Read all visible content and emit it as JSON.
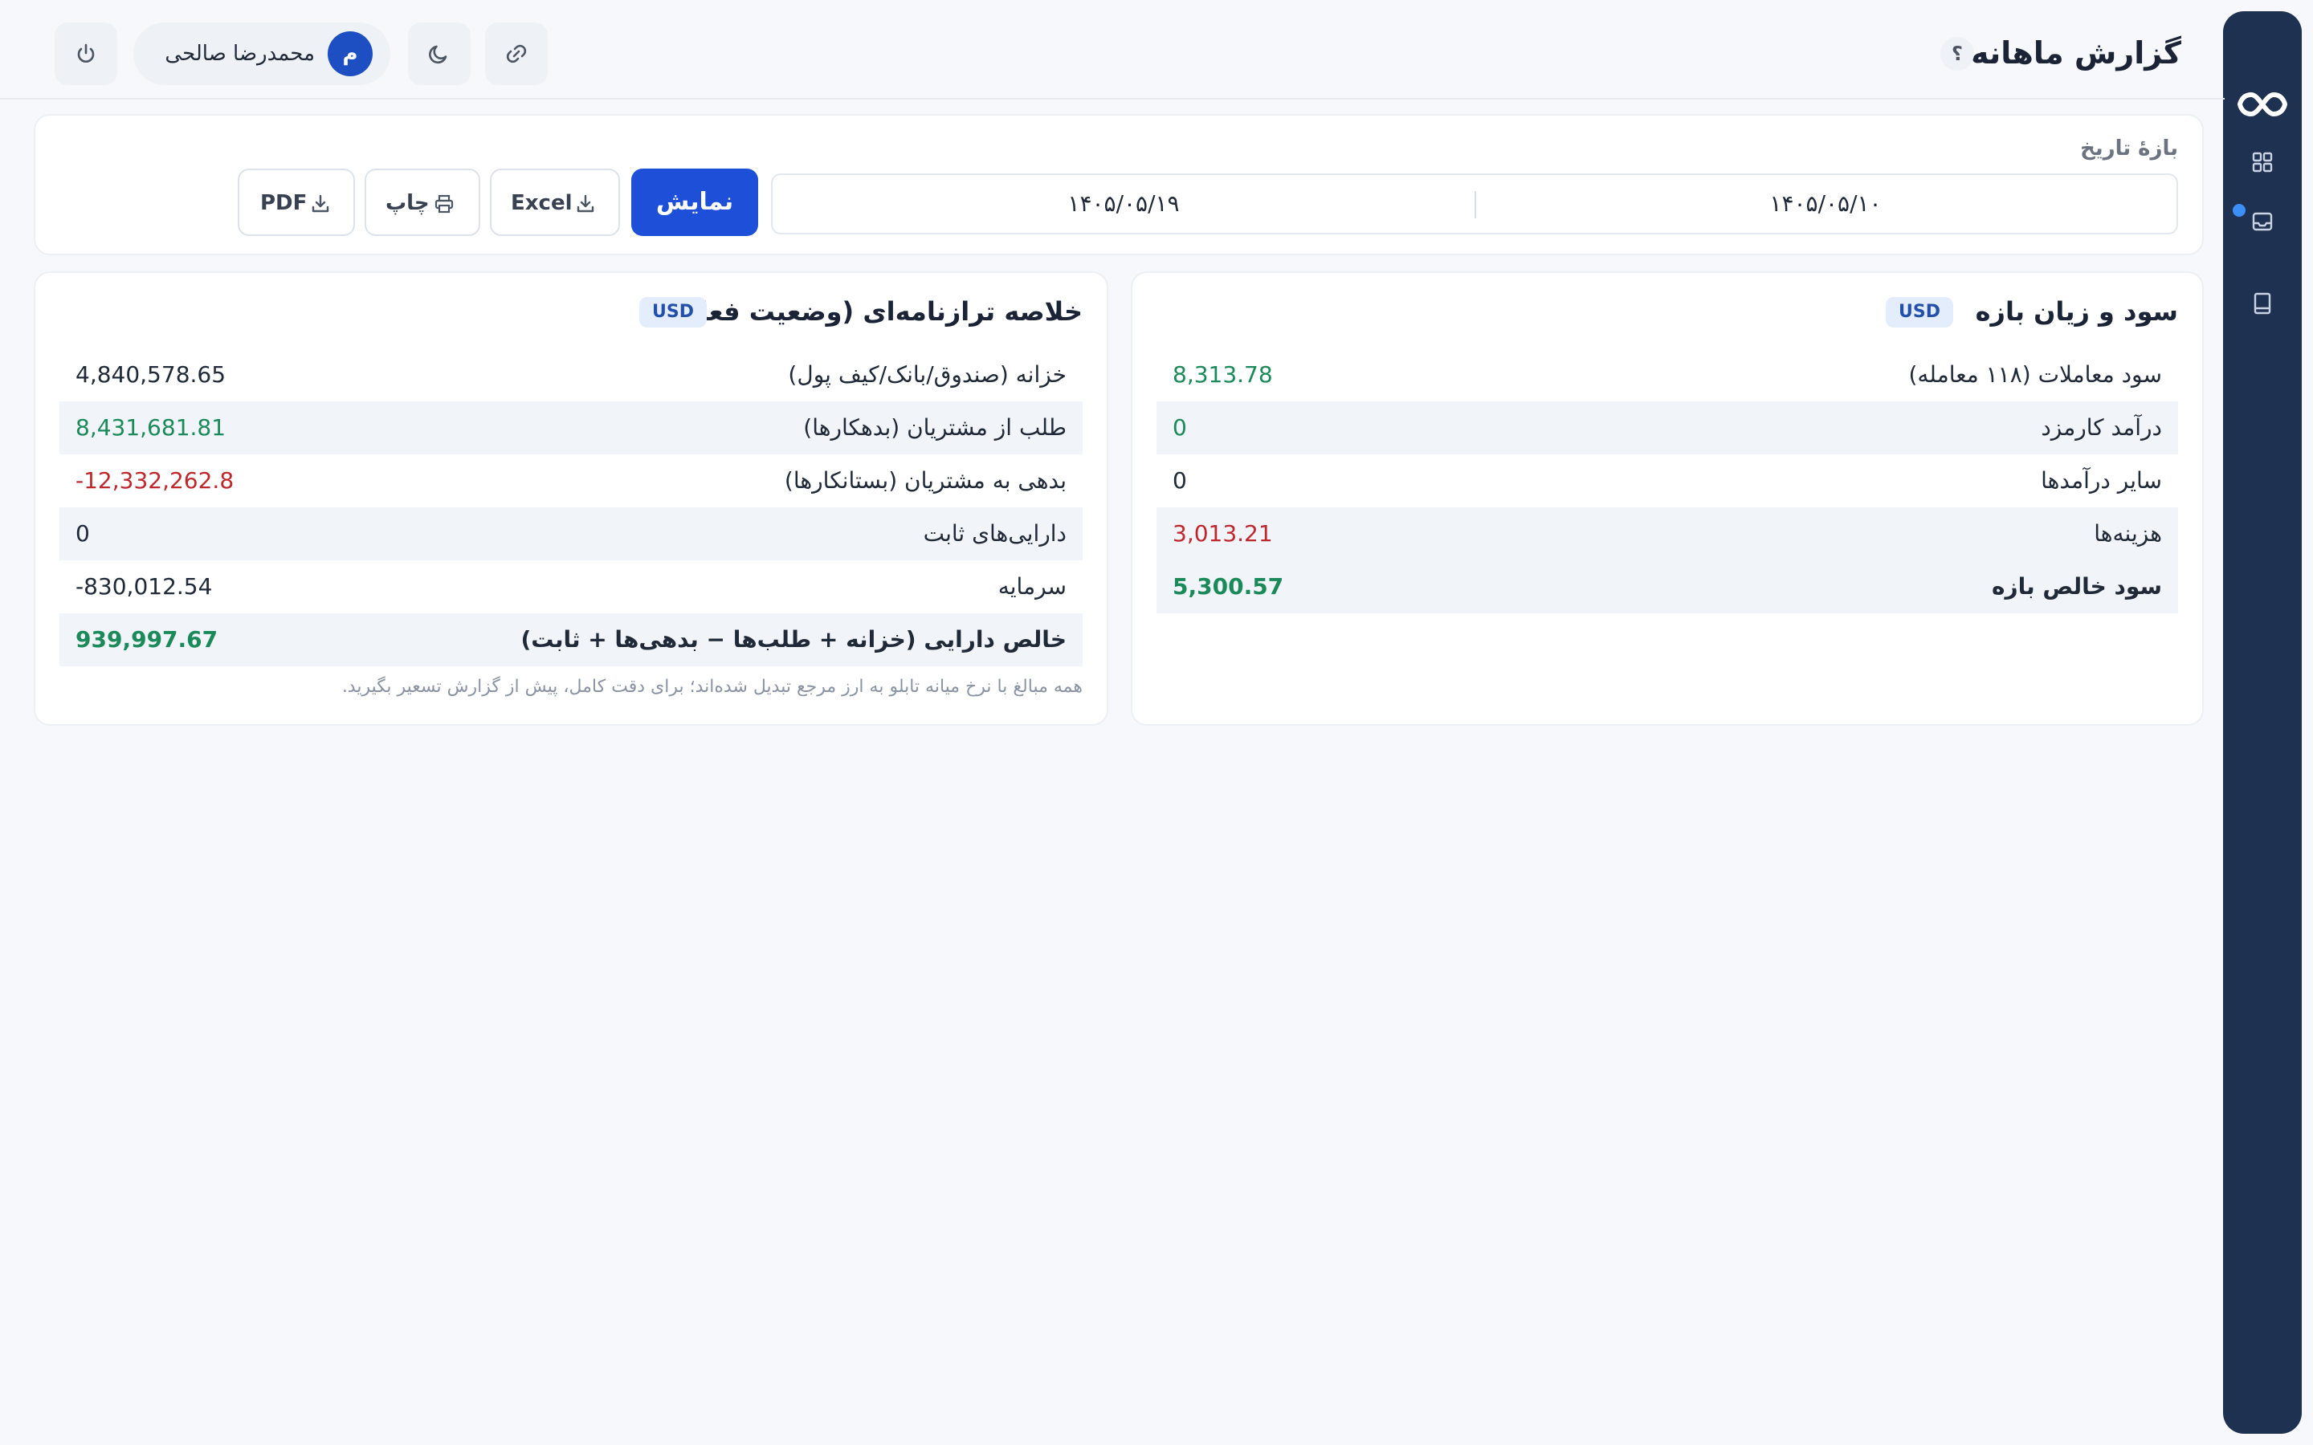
{
  "header": {
    "title": "گزارش ماهانه",
    "help_label": "؟",
    "user": {
      "name": "محمدرضا صالحی",
      "avatar_initial": "م"
    },
    "icons": [
      "power-icon",
      "moon-icon",
      "link-icon"
    ]
  },
  "sidebar": {
    "icons": [
      "infinity-logo-icon",
      "grid-icon",
      "inbox-icon",
      "book-icon"
    ],
    "accent_color": "#3b8ff6",
    "background": "#1f3150"
  },
  "filter": {
    "date_label": "بازهٔ تاریخ",
    "date_from": "۱۴۰۵/۰۵/۱۰",
    "date_to": "۱۴۰۵/۰۵/۱۹",
    "show_label": "نمایش",
    "excel_label": "Excel",
    "print_label": "چاپ",
    "pdf_label": "PDF"
  },
  "profit_loss": {
    "title": "سود و زیان بازه",
    "currency": "USD",
    "rows": [
      {
        "label": "سود معاملات (۱۱۸ معامله)",
        "value": "8,313.78",
        "tone": "pos"
      },
      {
        "label": "درآمد کارمزد",
        "value": "0",
        "tone": "pos"
      },
      {
        "label": "سایر درآمدها",
        "value": "0",
        "tone": "neu"
      },
      {
        "label": "هزینه‌ها",
        "value": "3,013.21",
        "tone": "neg"
      },
      {
        "label": "سود خالص بازه",
        "value": "5,300.57",
        "tone": "pos"
      }
    ]
  },
  "balance_sheet": {
    "title": "خلاصه ترازنامه‌ای (وضعیت فعلی)",
    "currency": "USD",
    "rows": [
      {
        "label": "خزانه (صندوق/بانک/کیف پول)",
        "value": "4,840,578.65",
        "tone": "neu"
      },
      {
        "label": "طلب از مشتریان (بدهکارها)",
        "value": "8,431,681.81",
        "tone": "pos"
      },
      {
        "label": "بدهی به مشتریان (بستانکارها)",
        "value": "-12,332,262.8",
        "tone": "neg"
      },
      {
        "label": "دارایی‌های ثابت",
        "value": "0",
        "tone": "neu"
      },
      {
        "label": "سرمایه",
        "value": "-830,012.54",
        "tone": "neu"
      },
      {
        "label": "خالص دارایی (خزانه + طلب‌ها − بدهی‌ها + ثابت)",
        "value": "939,997.67",
        "tone": "pos"
      }
    ],
    "footnote": "همه مبالغ با نرخ میانه تابلو به ارز مرجع تبدیل شده‌اند؛ برای دقت کامل، پیش از گزارش تسعیر بگیرید."
  },
  "colors": {
    "primary": "#1d4fd8",
    "positive": "#1b8a5a",
    "negative": "#c0272d"
  }
}
